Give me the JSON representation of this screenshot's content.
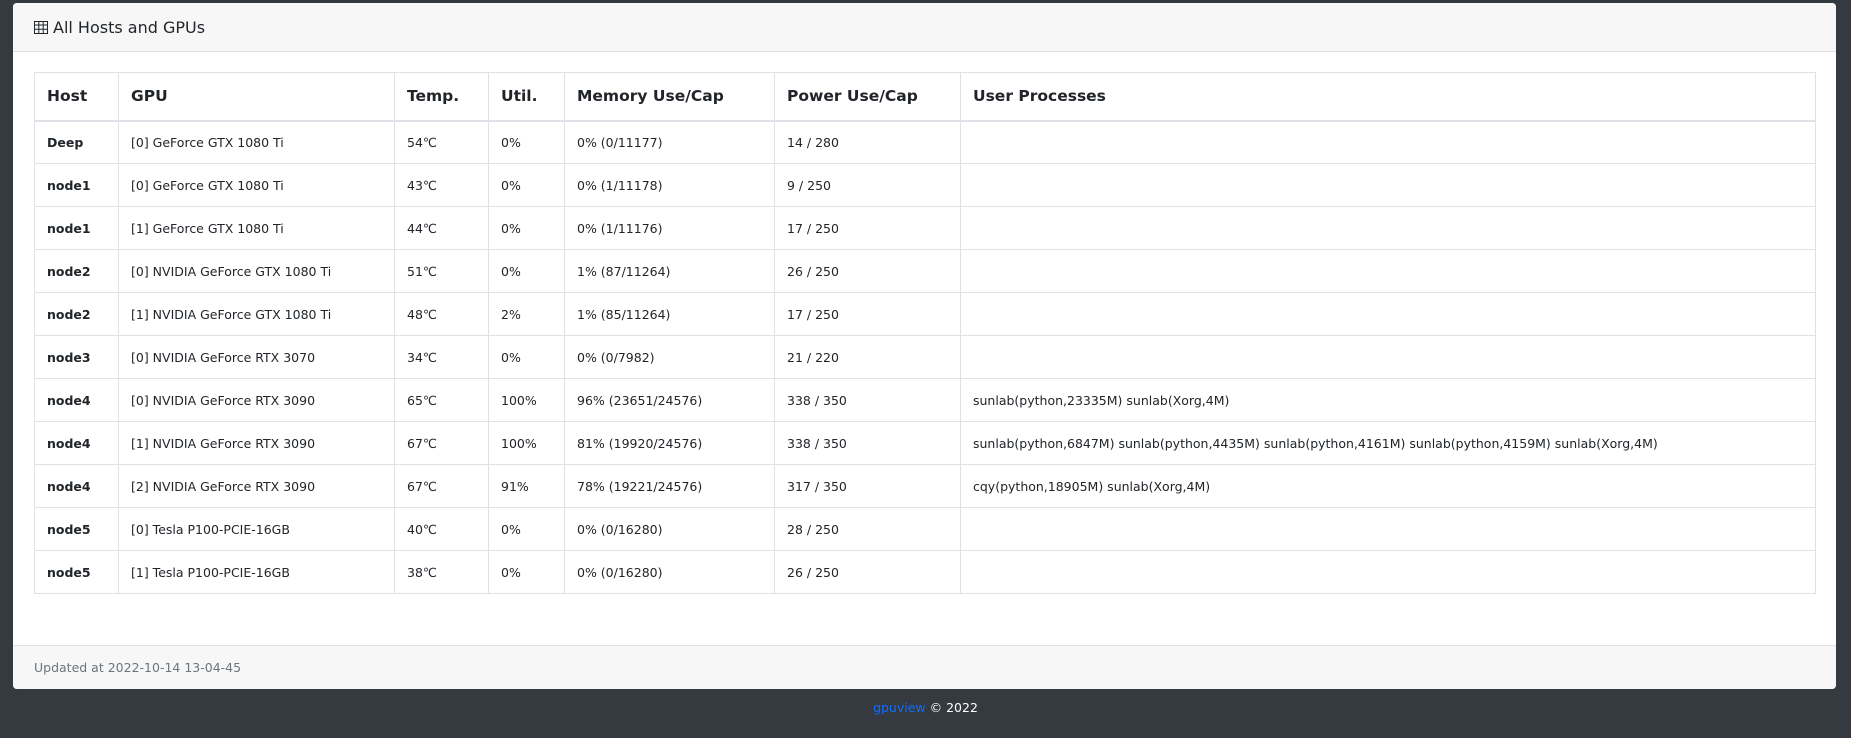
{
  "header": {
    "icon": "table-icon",
    "title": "All Hosts and GPUs"
  },
  "table": {
    "columns": [
      "Host",
      "GPU",
      "Temp.",
      "Util.",
      "Memory Use/Cap",
      "Power Use/Cap",
      "User Processes"
    ],
    "rows": [
      {
        "host": "Deep",
        "gpu": "[0] GeForce GTX 1080 Ti",
        "temp": "54℃",
        "util": "0%",
        "memory": "0% (0/11177)",
        "power": "14 / 280",
        "processes": ""
      },
      {
        "host": "node1",
        "gpu": "[0] GeForce GTX 1080 Ti",
        "temp": "43℃",
        "util": "0%",
        "memory": "0% (1/11178)",
        "power": "9 / 250",
        "processes": ""
      },
      {
        "host": "node1",
        "gpu": "[1] GeForce GTX 1080 Ti",
        "temp": "44℃",
        "util": "0%",
        "memory": "0% (1/11176)",
        "power": "17 / 250",
        "processes": ""
      },
      {
        "host": "node2",
        "gpu": "[0] NVIDIA GeForce GTX 1080 Ti",
        "temp": "51℃",
        "util": "0%",
        "memory": "1% (87/11264)",
        "power": "26 / 250",
        "processes": ""
      },
      {
        "host": "node2",
        "gpu": "[1] NVIDIA GeForce GTX 1080 Ti",
        "temp": "48℃",
        "util": "2%",
        "memory": "1% (85/11264)",
        "power": "17 / 250",
        "processes": ""
      },
      {
        "host": "node3",
        "gpu": "[0] NVIDIA GeForce RTX 3070",
        "temp": "34℃",
        "util": "0%",
        "memory": "0% (0/7982)",
        "power": "21 / 220",
        "processes": ""
      },
      {
        "host": "node4",
        "gpu": "[0] NVIDIA GeForce RTX 3090",
        "temp": "65℃",
        "util": "100%",
        "memory": "96% (23651/24576)",
        "power": "338 / 350",
        "processes": "sunlab(python,23335M) sunlab(Xorg,4M)"
      },
      {
        "host": "node4",
        "gpu": "[1] NVIDIA GeForce RTX 3090",
        "temp": "67℃",
        "util": "100%",
        "memory": "81% (19920/24576)",
        "power": "338 / 350",
        "processes": "sunlab(python,6847M) sunlab(python,4435M) sunlab(python,4161M) sunlab(python,4159M) sunlab(Xorg,4M)"
      },
      {
        "host": "node4",
        "gpu": "[2] NVIDIA GeForce RTX 3090",
        "temp": "67℃",
        "util": "91%",
        "memory": "78% (19221/24576)",
        "power": "317 / 350",
        "processes": "cqy(python,18905M) sunlab(Xorg,4M)"
      },
      {
        "host": "node5",
        "gpu": "[0] Tesla P100-PCIE-16GB",
        "temp": "40℃",
        "util": "0%",
        "memory": "0% (0/16280)",
        "power": "28 / 250",
        "processes": ""
      },
      {
        "host": "node5",
        "gpu": "[1] Tesla P100-PCIE-16GB",
        "temp": "38℃",
        "util": "0%",
        "memory": "0% (0/16280)",
        "power": "26 / 250",
        "processes": ""
      }
    ]
  },
  "footer": {
    "updated": "Updated at 2022-10-14 13-04-45"
  },
  "page_footer": {
    "link_label": "gpuview",
    "copyright": "© 2022"
  },
  "colors": {
    "background": "#343a40",
    "link": "#0d6efd",
    "header_bg": "#f7f7f7"
  }
}
